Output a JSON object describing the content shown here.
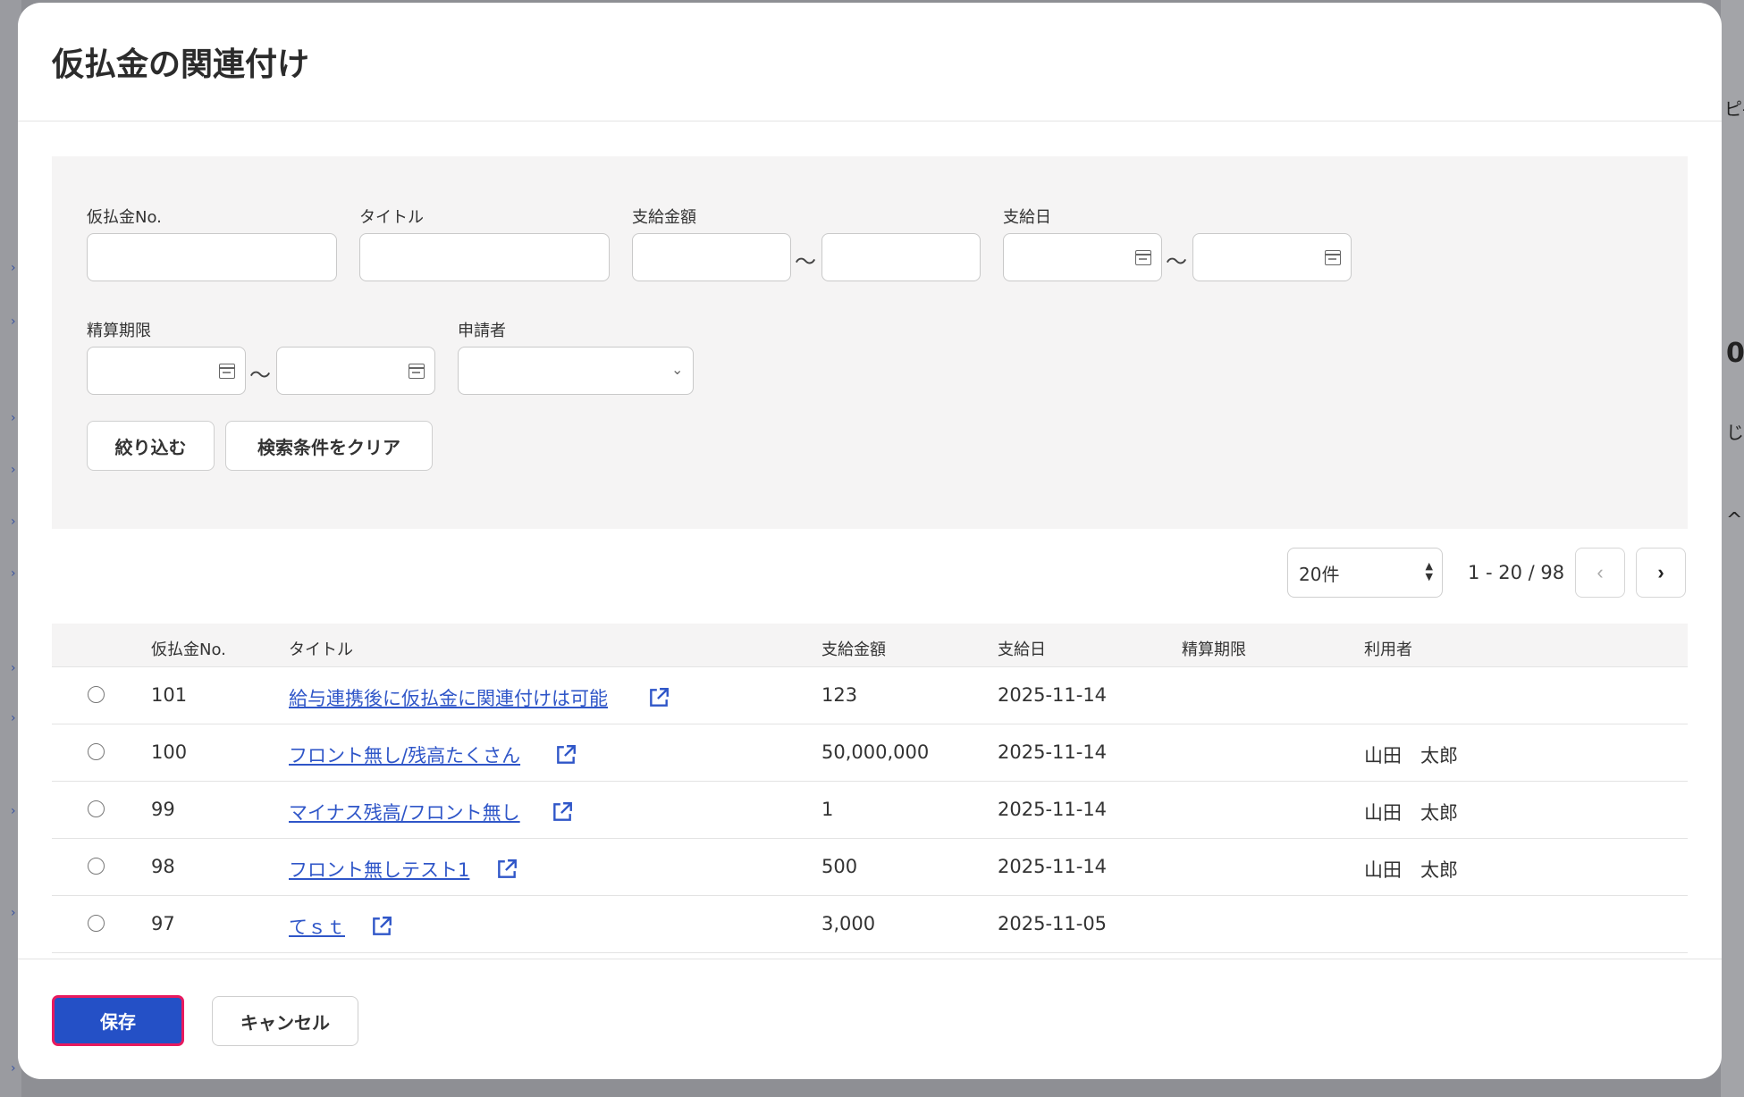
{
  "dialog": {
    "title": "仮払金の関連付け"
  },
  "filters": {
    "no_label": "仮払金No.",
    "title_label": "タイトル",
    "amount_label": "支給金額",
    "date_label": "支給日",
    "deadline_label": "精算期限",
    "applicant_label": "申請者",
    "range_separator": "〜",
    "filter_button": "絞り込む",
    "clear_button": "検索条件をクリア",
    "no_value": "",
    "title_value": "",
    "amount_from": "",
    "amount_to": "",
    "date_from": "",
    "date_to": "",
    "deadline_from": "",
    "deadline_to": "",
    "applicant_value": ""
  },
  "pagination": {
    "per_page": "20件",
    "range": "1 - 20 / 98"
  },
  "table": {
    "headers": {
      "no": "仮払金No.",
      "title": "タイトル",
      "amount": "支給金額",
      "date": "支給日",
      "deadline": "精算期限",
      "user": "利用者"
    },
    "rows": [
      {
        "no": "101",
        "title": "給与連携後に仮払金に関連付けは可能",
        "amount": "123",
        "date": "2025-11-14",
        "deadline": "",
        "user": ""
      },
      {
        "no": "100",
        "title": "フロント無し/残高たくさん",
        "amount": "50,000,000",
        "date": "2025-11-14",
        "deadline": "",
        "user": "山田　太郎"
      },
      {
        "no": "99",
        "title": "マイナス残高/フロント無し",
        "amount": "1",
        "date": "2025-11-14",
        "deadline": "",
        "user": "山田　太郎"
      },
      {
        "no": "98",
        "title": "フロント無しテスト1",
        "amount": "500",
        "date": "2025-11-14",
        "deadline": "",
        "user": "山田　太郎"
      },
      {
        "no": "97",
        "title": "てｓｔ",
        "amount": "3,000",
        "date": "2025-11-05",
        "deadline": "",
        "user": ""
      }
    ]
  },
  "footer": {
    "save_label": "保存",
    "cancel_label": "キャンセル"
  },
  "background": {
    "fragment_1": "ピ-",
    "fragment_2": "0",
    "fragment_3": "じ"
  },
  "colors": {
    "primary": "#2450c6",
    "link": "#2f56c8",
    "highlight_border": "#e81a5e",
    "panel_bg": "#f5f4f4"
  }
}
